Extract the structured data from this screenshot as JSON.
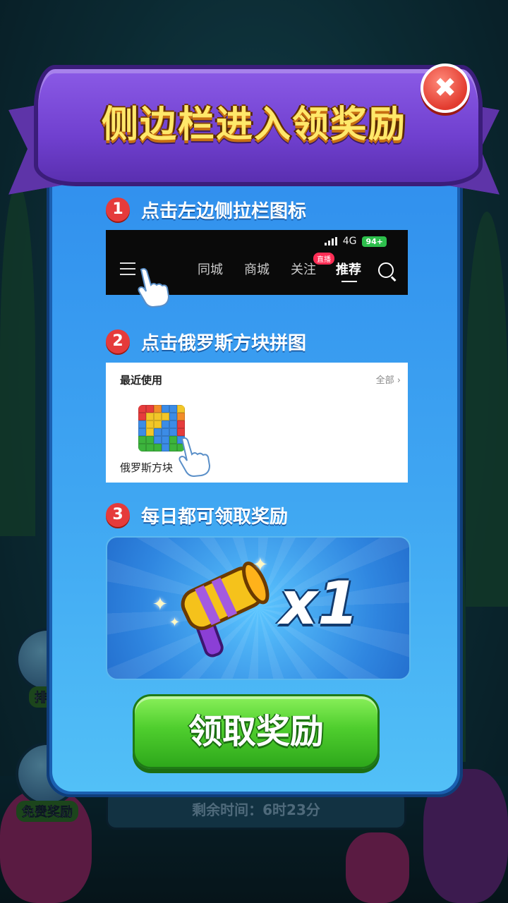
{
  "ribbon": {
    "title": "侧边栏进入领奖励"
  },
  "close": {
    "label": "✖"
  },
  "steps": [
    {
      "num": "1",
      "text": "点击左边侧拉栏图标"
    },
    {
      "num": "2",
      "text": "点击俄罗斯方块拼图"
    },
    {
      "num": "3",
      "text": "每日都可领取奖励"
    }
  ],
  "shot1": {
    "network": "4G",
    "battery": "94+",
    "nav": [
      "同城",
      "商城",
      "关注",
      "推荐"
    ],
    "live_badge": "直播"
  },
  "shot2": {
    "recent_title": "最近使用",
    "all_link": "全部 ›",
    "game_name": "俄罗斯方块"
  },
  "reward": {
    "count": "x1",
    "item": "hammer-icon"
  },
  "claim_button": {
    "label": "领取奖励"
  },
  "background": {
    "rank_label": "排行",
    "free_reward_label": "免费奖励",
    "time_remaining": "剩余时间：6时23分"
  },
  "colors": {
    "panel": "#3fa6f2",
    "ribbon": "#7040cf",
    "title": "#ffe86a",
    "claim": "#4fce2e",
    "step_badge": "#e53b3b"
  }
}
